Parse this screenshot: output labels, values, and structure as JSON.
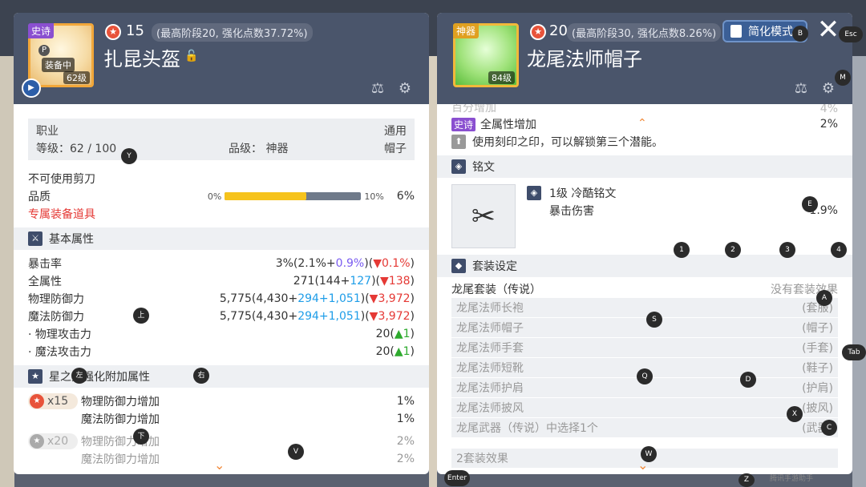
{
  "left": {
    "grade": "史诗",
    "equip_tag": "装备中",
    "p_tag": "P",
    "level_tag": "62级",
    "star_icon": "★",
    "stars": "15",
    "star_info": "(最高阶段20, 强化点数37.72%)",
    "name": "扎昆头盔",
    "info": {
      "job_label": "职业",
      "job_value": "通用",
      "level_text": "等级：62 / 100",
      "rank_text": "品级： 神器",
      "type_value": "帽子"
    },
    "no_scissors": "不可使用剪刀",
    "quality_label": "品质",
    "quality_min": "0%",
    "quality_max": "10%",
    "quality_value": "6%",
    "quality_fraction": 0.6,
    "exclusive": "专属装备道具",
    "basic_title": "基本属性",
    "stats": [
      {
        "name": "暴击率",
        "total": "3%(2.1%+",
        "mid": "0.9%",
        "mid_color": "purple",
        "tail": ")(",
        "down": "▼0.1%",
        "end": ")"
      },
      {
        "name": "全属性",
        "total": "271(144+",
        "mid": "127",
        "mid_color": "blue",
        "tail": ")(",
        "down": "▼138",
        "end": ")"
      },
      {
        "name": "物理防御力",
        "total": "5,775(4,430+",
        "mid": "294",
        "mid_color": "blue",
        "mid2": "+1,051",
        "tail": ")(",
        "down": "▼3,972",
        "end": ")"
      },
      {
        "name": "魔法防御力",
        "total": "5,775(4,430+",
        "mid": "294",
        "mid_color": "blue",
        "mid2": "+1,051",
        "tail": ")(",
        "down": "▼3,972",
        "end": ")"
      }
    ],
    "sub_stats": [
      {
        "name": "· 物理攻击力",
        "value": "20(",
        "up": "▲1",
        "end": ")"
      },
      {
        "name": "· 魔法攻击力",
        "value": "20(",
        "up": "▲1",
        "end": ")"
      }
    ],
    "star_section_title": "星之力强化附加属性",
    "star_tiers": [
      {
        "count": "x15",
        "active": true,
        "lines": [
          {
            "name": "物理防御力增加",
            "value": "1%"
          },
          {
            "name": "魔法防御力增加",
            "value": "1%"
          }
        ]
      },
      {
        "count": "x20",
        "active": false,
        "lines": [
          {
            "name": "物理防御力增加",
            "value": "2%"
          },
          {
            "name": "魔法防御力增加",
            "value": "2%"
          }
        ]
      }
    ]
  },
  "right": {
    "grade": "神器",
    "level_tag": "84级",
    "star_icon": "★",
    "stars": "20",
    "star_info": "(最高阶段30, 强化点数8.26%)",
    "name": "龙尾法师帽子",
    "simple_mode": "简化模式",
    "close_glyph": "✕",
    "partial_top": "百分增加",
    "partial_top_value": "4%",
    "potential_grade": "史诗",
    "potential_line": "全属性增加",
    "potential_value": "2%",
    "unlock_text": "使用刻印之印，可以解锁第三个潜能。",
    "inscription_title": "铭文",
    "rune_name": "1级 冷酷铭文",
    "rune_stat": "暴击伤害",
    "rune_value": "1.9%",
    "set_title": "套装设定",
    "set_name": "龙尾套装（传说）",
    "set_status": "没有套装效果",
    "set_items": [
      {
        "name": "龙尾法师长袍",
        "slot": "(套服)"
      },
      {
        "name": "龙尾法师帽子",
        "slot": "(帽子)"
      },
      {
        "name": "龙尾法师手套",
        "slot": "(手套)"
      },
      {
        "name": "龙尾法师短靴",
        "slot": "(鞋子)"
      },
      {
        "name": "龙尾法师护肩",
        "slot": "(护肩)"
      },
      {
        "name": "龙尾法师披风",
        "slot": "(披风)"
      },
      {
        "name": "龙尾武器（传说）中选择1个",
        "slot": "(武器)"
      }
    ],
    "set_effect_2": "2套装效果"
  },
  "keys": {
    "esc": "Esc",
    "b": "B",
    "m": "M",
    "y": "Y",
    "e": "E",
    "n1": "1",
    "n2": "2",
    "n3": "3",
    "n4": "4",
    "a": "A",
    "s": "S",
    "up": "上",
    "left": "左",
    "right": "右",
    "q": "Q",
    "d": "D",
    "tab": "Tab",
    "x": "X",
    "c": "C",
    "down": "下",
    "v": "V",
    "w": "W",
    "enter": "Enter",
    "z": "Z"
  },
  "watermark": "腾讯手游助手",
  "colors": {
    "accent_red": "#e53935",
    "accent_blue": "#1e9de8",
    "accent_purple": "#7a5cf0",
    "up_green": "#2eaa2e",
    "header_bg": "#4a556b"
  }
}
